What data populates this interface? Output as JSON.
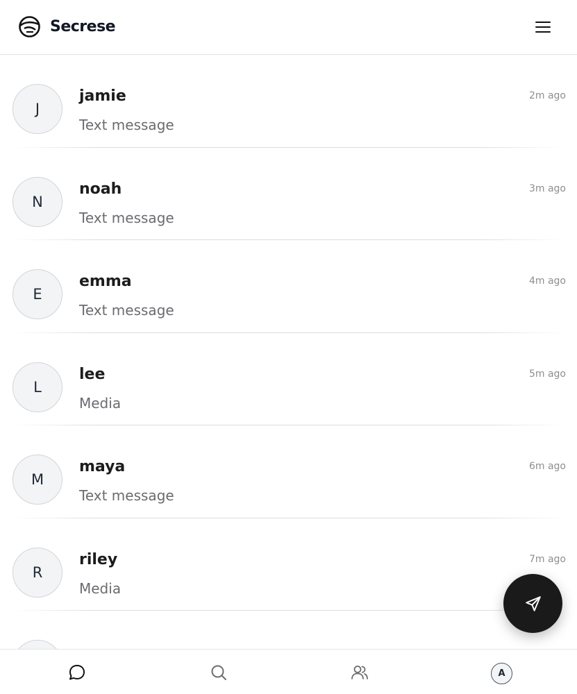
{
  "app": {
    "brand": "Secrese"
  },
  "icons": {
    "logo": "secrese-logo-icon",
    "menu": "hamburger-menu-icon",
    "fab": "send-icon",
    "nav_chats": "chat-bubble-icon",
    "nav_search": "search-icon",
    "nav_contacts": "users-icon"
  },
  "conversations": [
    {
      "initial": "J",
      "name": "jamie",
      "preview": "Text message",
      "time": "2m ago"
    },
    {
      "initial": "N",
      "name": "noah",
      "preview": "Text message",
      "time": "3m ago"
    },
    {
      "initial": "E",
      "name": "emma",
      "preview": "Text message",
      "time": "4m ago"
    },
    {
      "initial": "L",
      "name": "lee",
      "preview": "Media",
      "time": "5m ago"
    },
    {
      "initial": "M",
      "name": "maya",
      "preview": "Text message",
      "time": "6m ago"
    },
    {
      "initial": "R",
      "name": "riley",
      "preview": "Media",
      "time": "7m ago"
    }
  ],
  "bottom_nav": {
    "profile_initial": "A"
  },
  "colors": {
    "fab_bg": "#1a1a1a",
    "avatar_bg": "#f3f4f6",
    "muted_text": "#6b6b70"
  }
}
